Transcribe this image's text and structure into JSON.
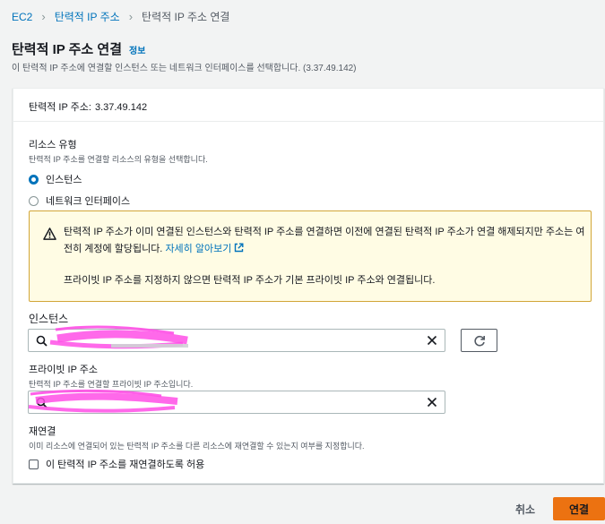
{
  "breadcrumb": {
    "items": [
      "EC2",
      "탄력적 IP 주소",
      "탄력적 IP 주소 연결"
    ]
  },
  "header": {
    "title": "탄력적 IP 주소 연결",
    "info_link": "정보",
    "description": "이 탄력적 IP 주소에 연결할 인스턴스 또는 네트워크 인터페이스를 선택합니다. (3.37.49.142)"
  },
  "panel": {
    "ip_label": "탄력적 IP 주소:",
    "ip_value": "3.37.49.142"
  },
  "resource_type": {
    "label": "리소스 유형",
    "description": "탄력적 IP 주소를 연결할 리소스의 유형을 선택합니다.",
    "options": [
      {
        "label": "인스턴스",
        "selected": true
      },
      {
        "label": "네트워크 인터페이스",
        "selected": false
      }
    ]
  },
  "alert": {
    "text": "탄력적 IP 주소가 이미 연결된 인스턴스와 탄력적 IP 주소를 연결하면 이전에 연결된 탄력적 IP 주소가 연결 해제되지만 주소는 여전히 계정에 할당됩니다.",
    "link": "자세히 알아보기",
    "text2": "프라이빗 IP 주소를 지정하지 않으면 탄력적 IP 주소가 기본 프라이빗 IP 주소와 연결됩니다."
  },
  "instance": {
    "label": "인스턴스",
    "value": ""
  },
  "private_ip": {
    "label": "프라이빗 IP 주소",
    "description": "탄력적 IP 주소를 연결할 프라이빗 IP 주소입니다.",
    "value": ""
  },
  "reassociation": {
    "label": "재연결",
    "description": "이미 리소스에 연결되어 있는 탄력적 IP 주소를 다른 리소스에 재연결할 수 있는지 여부를 지정합니다.",
    "checkbox_label": "이 탄력적 IP 주소를 재연결하도록 허용",
    "checked": false
  },
  "actions": {
    "cancel": "취소",
    "submit": "연결"
  },
  "colors": {
    "link": "#0073bb",
    "primary": "#ec7211",
    "warning_bg": "#fffce4",
    "warning_border": "#d2a638",
    "redaction": "#ff4fe6"
  }
}
